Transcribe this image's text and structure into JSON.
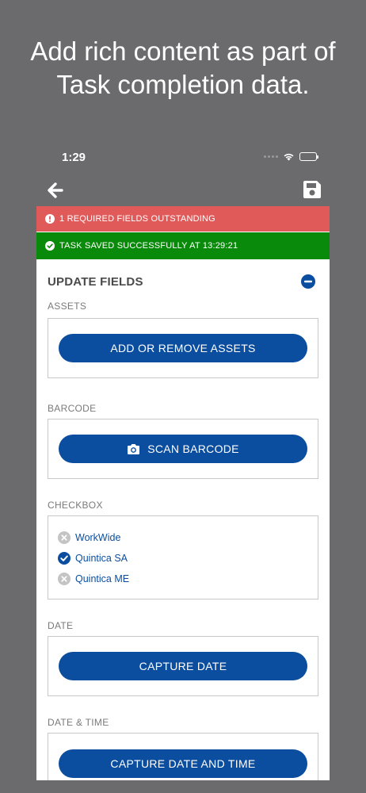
{
  "promo": {
    "line1": "Add rich content as part of",
    "line2": "Task completion data."
  },
  "status_bar": {
    "time": "1:29"
  },
  "banners": {
    "error": "1 REQUIRED FIELDS OUTSTANDING",
    "success": "TASK SAVED SUCCESSFULLY AT 13:29:21"
  },
  "section": {
    "title": "UPDATE FIELDS"
  },
  "fields": {
    "assets": {
      "label": "ASSETS",
      "button": "ADD OR REMOVE ASSETS"
    },
    "barcode": {
      "label": "BARCODE",
      "button": "SCAN BARCODE"
    },
    "checkbox": {
      "label": "CHECKBOX",
      "options": [
        {
          "label": "WorkWide",
          "checked": false
        },
        {
          "label": "Quintica SA",
          "checked": true
        },
        {
          "label": "Quintica ME",
          "checked": false
        }
      ]
    },
    "date": {
      "label": "DATE",
      "button": "CAPTURE DATE"
    },
    "datetime": {
      "label": "DATE & TIME",
      "button": "CAPTURE DATE AND TIME"
    }
  },
  "colors": {
    "primary": "#0b4d9e",
    "error_banner": "#e05a5a",
    "success_banner": "#0a8a0a",
    "chrome": "#6b6a6c",
    "unchecked": "#c4c4c4"
  },
  "icons": {
    "back": "arrow-left-icon",
    "save": "floppy-disk-icon",
    "error": "exclamation-circle-icon",
    "success": "check-circle-icon",
    "collapse": "minus-circle-icon",
    "camera": "camera-icon",
    "checked": "check-circle-icon",
    "unchecked": "x-circle-icon"
  }
}
